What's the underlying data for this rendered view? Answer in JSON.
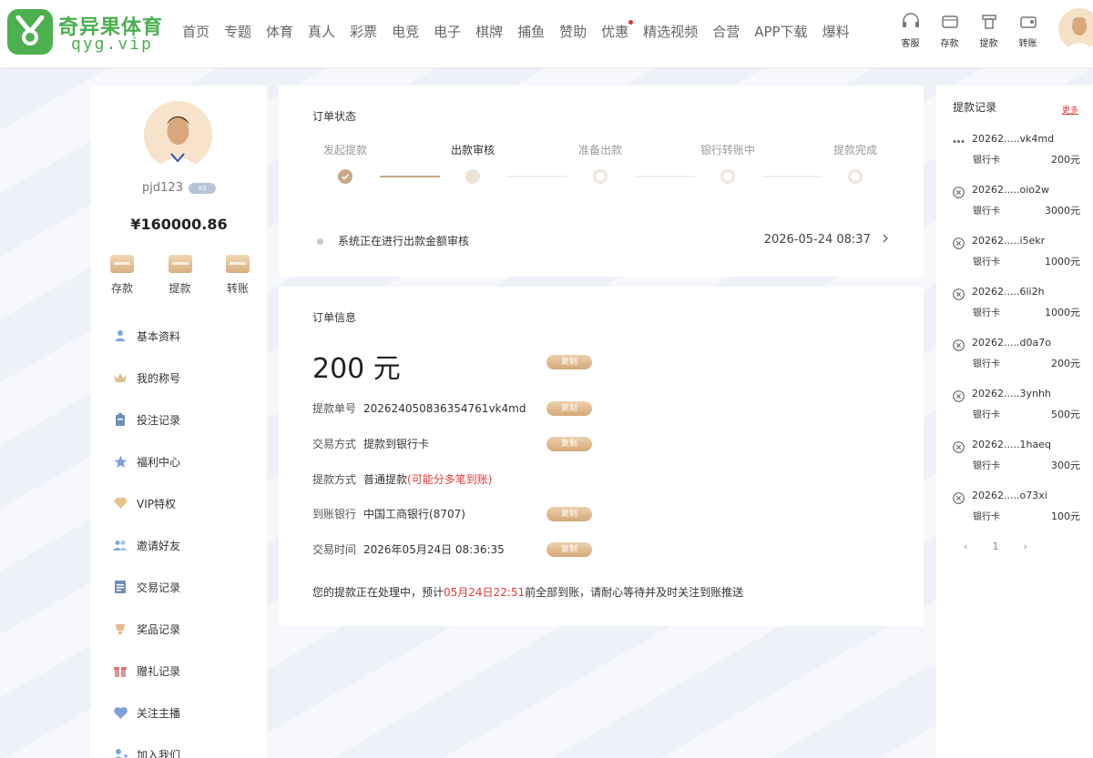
{
  "header": {
    "brand_name": "奇异果体育",
    "brand_domain": "qyg.vip",
    "nav": [
      "首页",
      "专题",
      "体育",
      "真人",
      "彩票",
      "电竞",
      "电子",
      "棋牌",
      "捕鱼",
      "赞助",
      "优惠",
      "精选视频",
      "合营",
      "APP下载",
      "爆料"
    ],
    "tools": [
      "客服",
      "存款",
      "提款",
      "转账"
    ]
  },
  "sidebar": {
    "username": "pjd123",
    "vip": "V3",
    "balance": "¥160000.86",
    "actions": [
      "存款",
      "提款",
      "转账"
    ],
    "menu": [
      "基本资料",
      "我的称号",
      "投注记录",
      "福利中心",
      "VIP特权",
      "邀请好友",
      "交易记录",
      "奖品记录",
      "赠礼记录",
      "关注主播",
      "加入我们"
    ]
  },
  "order_status": {
    "title": "订单状态",
    "steps": [
      "发起提款",
      "出款审核",
      "准备出款",
      "银行转账中",
      "提款完成"
    ],
    "status_text": "系统正在进行出款金额审核",
    "status_time": "2026-05-24 08:37"
  },
  "order_info": {
    "title": "订单信息",
    "amount": "200 元",
    "copy_label": "复制",
    "rows": {
      "order_no": {
        "label": "提款单号",
        "value": "202624050836354761vk4md"
      },
      "method": {
        "label": "交易方式",
        "value": "提款到银行卡"
      },
      "type": {
        "label": "提款方式",
        "value": "普通提款",
        "note": "(可能分多笔到账)"
      },
      "bank": {
        "label": "到账银行",
        "value": "中国工商银行(8707)"
      },
      "time": {
        "label": "交易时间",
        "value": "2026年05月24日 08:36:35"
      }
    },
    "notice_prefix": "您的提款正在处理中，预计",
    "notice_time": "05月24日22:51",
    "notice_suffix": "前全部到账，请耐心等待并及时关注到账推送"
  },
  "records": {
    "title": "提款记录",
    "more": "更多",
    "items": [
      {
        "id": "20262.....vk4md",
        "type": "银行卡",
        "amount": "200元",
        "status": "pending"
      },
      {
        "id": "20262.....oio2w",
        "type": "银行卡",
        "amount": "3000元",
        "status": "failed"
      },
      {
        "id": "20262.....i5ekr",
        "type": "银行卡",
        "amount": "1000元",
        "status": "failed"
      },
      {
        "id": "20262.....6li2h",
        "type": "银行卡",
        "amount": "1000元",
        "status": "failed"
      },
      {
        "id": "20262.....d0a7o",
        "type": "银行卡",
        "amount": "200元",
        "status": "failed"
      },
      {
        "id": "20262.....3ynhh",
        "type": "银行卡",
        "amount": "500元",
        "status": "failed"
      },
      {
        "id": "20262.....1haeq",
        "type": "银行卡",
        "amount": "300元",
        "status": "failed"
      },
      {
        "id": "20262.....o73xi",
        "type": "银行卡",
        "amount": "100元",
        "status": "failed"
      }
    ],
    "pager": {
      "prev": "‹",
      "page": "1",
      "next": "›"
    }
  },
  "colors": {
    "brand": "#4caf50",
    "accent": "#d6a978",
    "alert": "#e03a3a"
  }
}
